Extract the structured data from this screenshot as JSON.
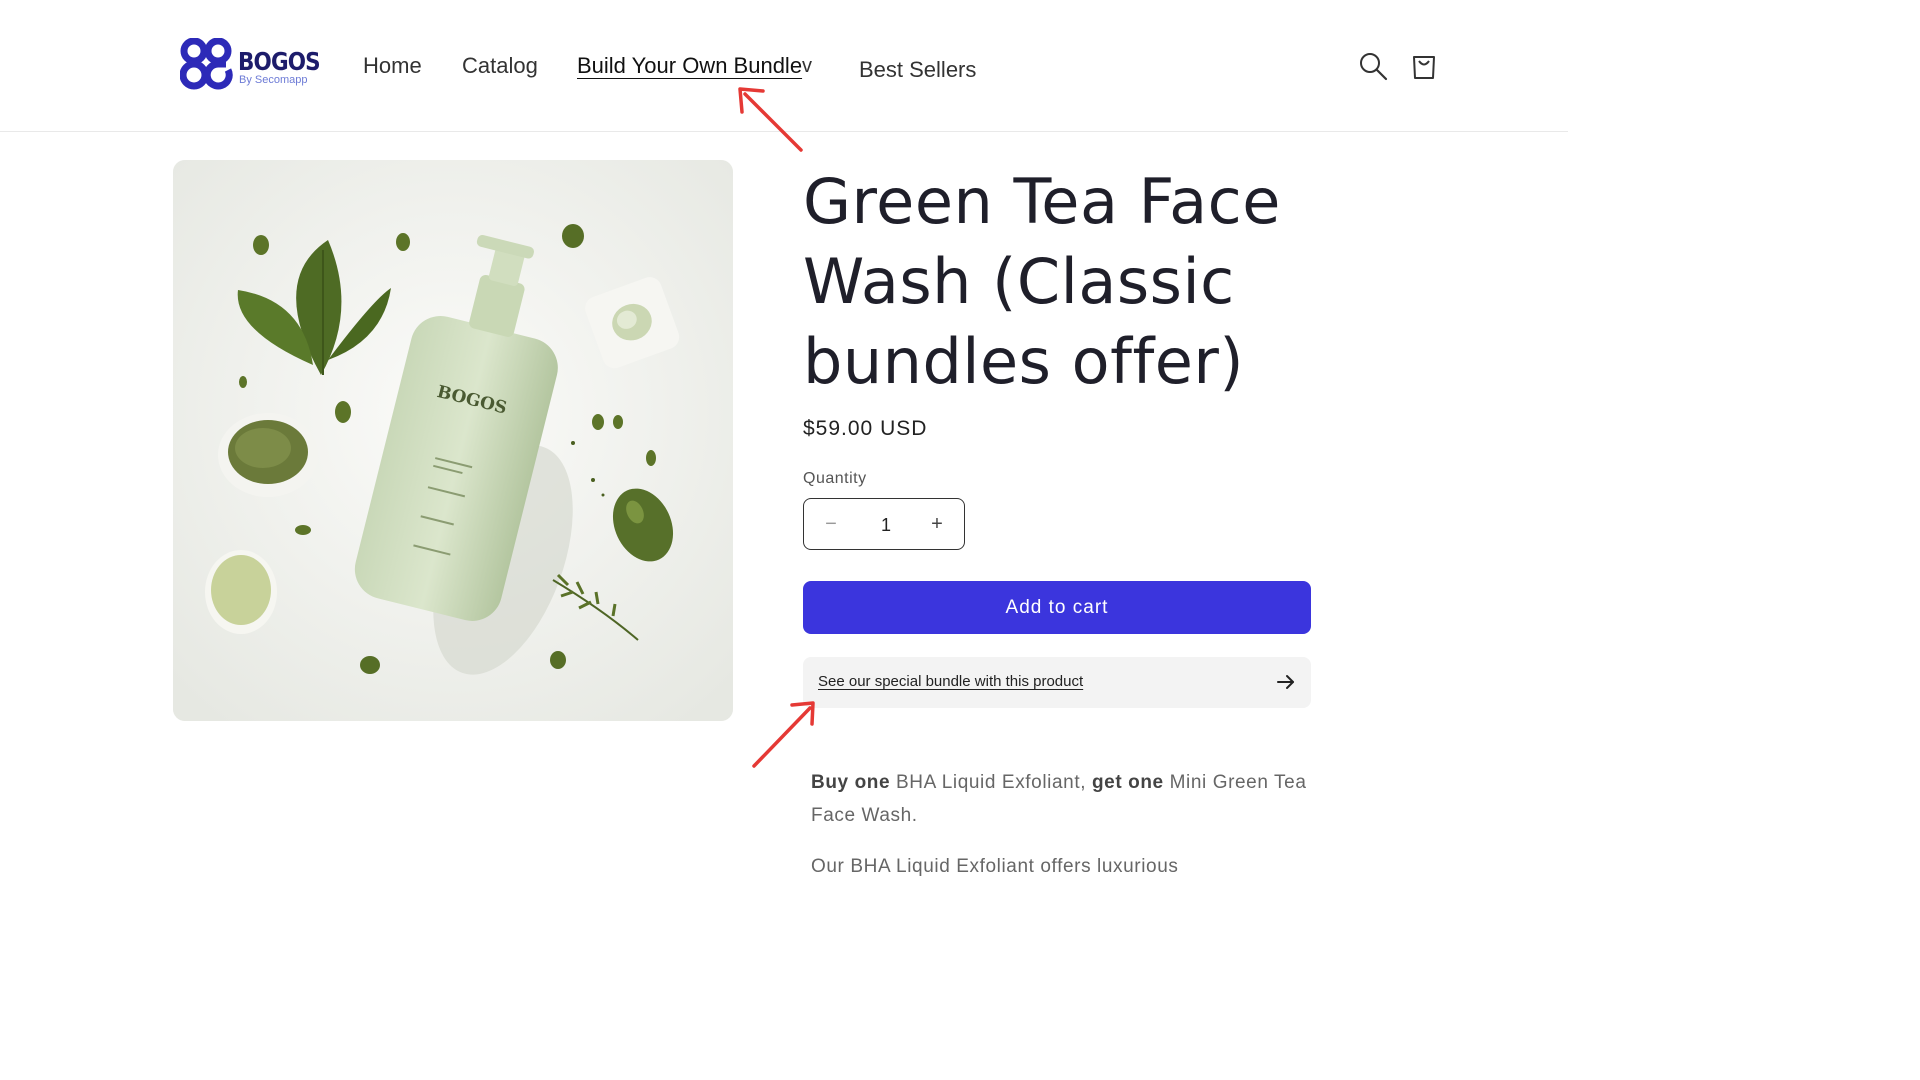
{
  "header": {
    "logo": {
      "wordmark": "BOGOS",
      "tagline": "By Secomapp",
      "mark": "BG"
    },
    "nav": {
      "home": "Home",
      "catalog": "Catalog",
      "bundle": "Build Your Own Bundle",
      "bundle_caret": "v",
      "best_sellers": "Best Sellers"
    },
    "icons": {
      "search": "search-icon",
      "cart": "cart-icon"
    }
  },
  "product": {
    "image_brand_label": "BOGOS",
    "title": "Green Tea Face Wash (Classic bundles offer)",
    "price": "$59.00 USD",
    "quantity_label": "Quantity",
    "quantity_value": "1",
    "minus_glyph": "−",
    "plus_glyph": "+",
    "add_to_cart_label": "Add to cart",
    "bundle_link_label": "See our special bundle with this product",
    "description": {
      "p1_buy": "Buy one",
      "p1_item1": " BHA Liquid Exfoliant, ",
      "p1_get": "get one",
      "p1_item2": " Mini Green Tea Face Wash.",
      "p2": "Our BHA Liquid Exfoliant offers luxurious"
    }
  },
  "colors": {
    "accent": "#3b35dd",
    "logo_navy": "#1d1c6b",
    "annotation_arrow": "#e53935",
    "bundle_box_bg": "#f3f3f3"
  }
}
